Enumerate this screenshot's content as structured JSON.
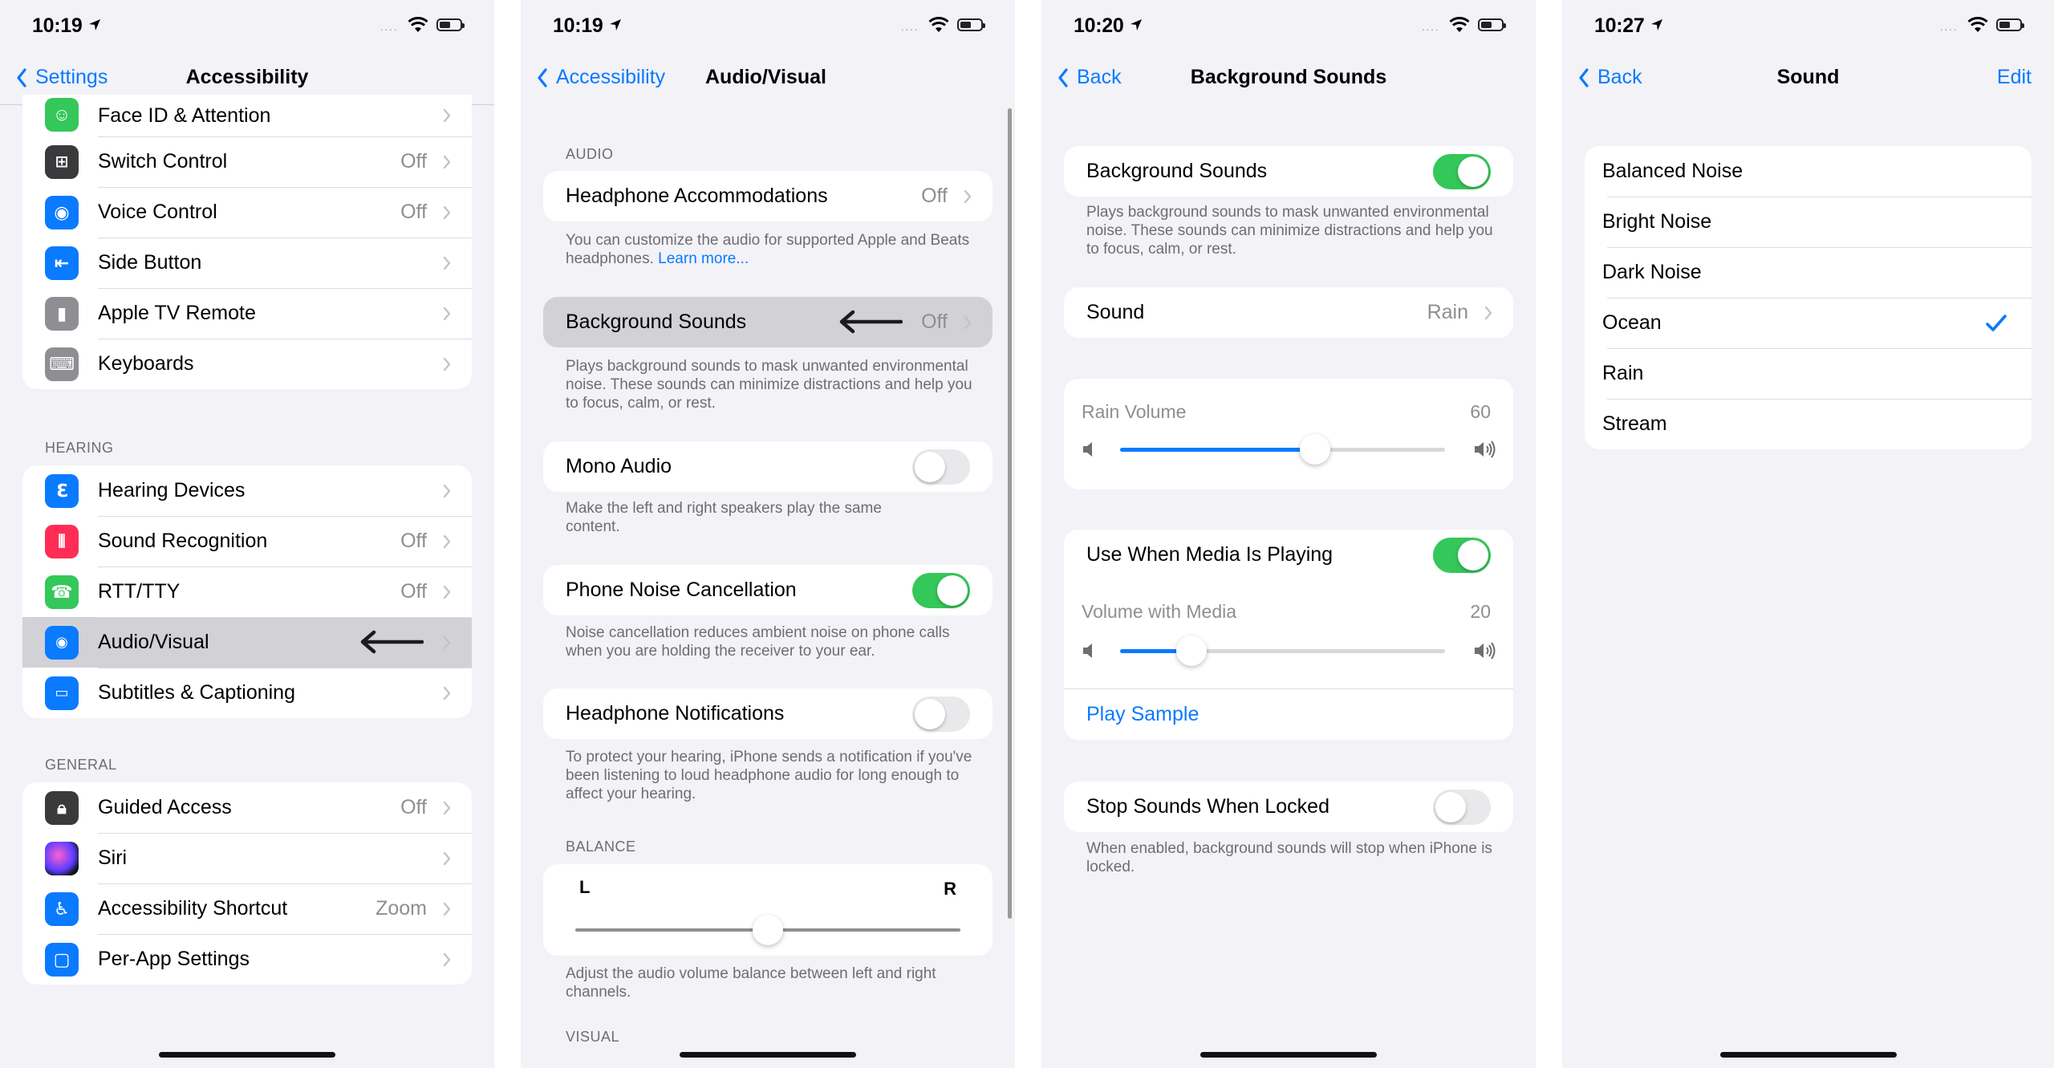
{
  "colors": {
    "accent": "#0a7aff",
    "toggle_on": "#34c759",
    "grouped_bg": "#f2f2f7"
  },
  "screen1": {
    "time": "10:19",
    "back": "Settings",
    "title": "Accessibility",
    "items_top": [
      {
        "label": "Face ID & Attention",
        "value": "",
        "icon": "face-id-icon"
      },
      {
        "label": "Switch Control",
        "value": "Off",
        "icon": "switch-control-icon"
      },
      {
        "label": "Voice Control",
        "value": "Off",
        "icon": "voice-control-icon"
      },
      {
        "label": "Side Button",
        "value": "",
        "icon": "side-button-icon"
      },
      {
        "label": "Apple TV Remote",
        "value": "",
        "icon": "apple-tv-remote-icon"
      },
      {
        "label": "Keyboards",
        "value": "",
        "icon": "keyboard-icon"
      }
    ],
    "hearing_header": "HEARING",
    "hearing": [
      {
        "label": "Hearing Devices",
        "value": "",
        "icon": "ear-icon"
      },
      {
        "label": "Sound Recognition",
        "value": "Off",
        "icon": "sound-recognition-icon"
      },
      {
        "label": "RTT/TTY",
        "value": "Off",
        "icon": "rtt-tty-icon"
      },
      {
        "label": "Audio/Visual",
        "value": "",
        "icon": "audio-visual-icon"
      },
      {
        "label": "Subtitles & Captioning",
        "value": "",
        "icon": "subtitles-icon"
      }
    ],
    "general_header": "GENERAL",
    "general": [
      {
        "label": "Guided Access",
        "value": "Off",
        "icon": "guided-access-icon"
      },
      {
        "label": "Siri",
        "value": "",
        "icon": "siri-icon"
      },
      {
        "label": "Accessibility Shortcut",
        "value": "Zoom",
        "icon": "accessibility-icon"
      },
      {
        "label": "Per-App Settings",
        "value": "",
        "icon": "per-app-icon"
      }
    ]
  },
  "screen2": {
    "time": "10:19",
    "back": "Accessibility",
    "title": "Audio/Visual",
    "audio_header": "AUDIO",
    "headphone_acc": {
      "label": "Headphone Accommodations",
      "value": "Off"
    },
    "headphone_acc_note": "You can customize the audio for supported Apple and Beats headphones.",
    "learn_more": "Learn more...",
    "bg_sounds": {
      "label": "Background Sounds",
      "value": "Off"
    },
    "bg_sounds_note": "Plays background sounds to mask unwanted environmental noise. These sounds can minimize distractions and help you to focus, calm, or rest.",
    "mono": {
      "label": "Mono Audio",
      "on": false
    },
    "mono_note": "Make the left and right speakers play the same content.",
    "noise": {
      "label": "Phone Noise Cancellation",
      "on": true
    },
    "noise_note": "Noise cancellation reduces ambient noise on phone calls when you are holding the receiver to your ear.",
    "hp_notif": {
      "label": "Headphone Notifications",
      "on": false
    },
    "hp_notif_note": "To protect your hearing, iPhone sends a notification if you've been listening to loud headphone audio for long enough to affect your hearing.",
    "balance_header": "BALANCE",
    "balance": {
      "left": "L",
      "right": "R",
      "value": 0.5
    },
    "balance_note": "Adjust the audio volume balance between left and right channels.",
    "visual_header": "VISUAL"
  },
  "screen3": {
    "time": "10:20",
    "back": "Back",
    "title": "Background Sounds",
    "bg": {
      "label": "Background Sounds",
      "on": true
    },
    "bg_note": "Plays background sounds to mask unwanted environmental noise. These sounds can minimize distractions and help you to focus, calm, or rest.",
    "sound": {
      "label": "Sound",
      "value": "Rain"
    },
    "rain_volume": {
      "label": "Rain Volume",
      "value": "60",
      "fraction": 0.6
    },
    "media": {
      "label": "Use When Media Is Playing",
      "on": true
    },
    "media_volume": {
      "label": "Volume with Media",
      "value": "20",
      "fraction": 0.22
    },
    "play_sample": "Play Sample",
    "stop": {
      "label": "Stop Sounds When Locked",
      "on": false
    },
    "stop_note": "When enabled, background sounds will stop when iPhone is locked."
  },
  "screen4": {
    "time": "10:27",
    "back": "Back",
    "title": "Sound",
    "edit": "Edit",
    "options": [
      "Balanced Noise",
      "Bright Noise",
      "Dark Noise",
      "Ocean",
      "Rain",
      "Stream"
    ],
    "selected": "Ocean"
  }
}
